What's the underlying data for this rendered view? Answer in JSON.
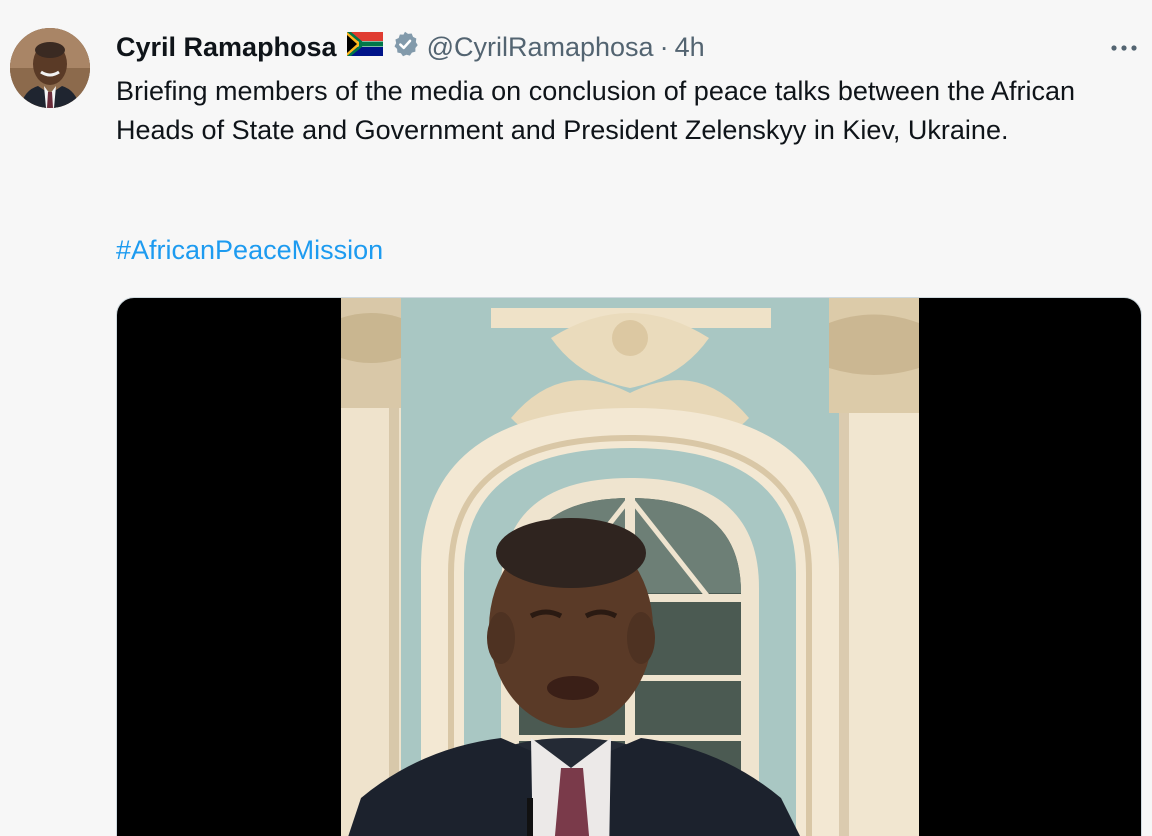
{
  "author": {
    "name": "Cyril Ramaphosa",
    "handle": "@CyrilRamaphosa",
    "separator": "·",
    "time": "4h",
    "flag_icon": "south-africa-flag-icon",
    "verified_icon": "verified-badge-icon",
    "avatar": "profile-photo"
  },
  "tweet": {
    "text": "Briefing members of the media on conclusion of peace talks between the African Heads of State and Government and President Zelenskyy in Kiev, Ukraine.",
    "hashtag": "#AfricanPeaceMission"
  },
  "menu": {
    "icon": "more-options-icon"
  },
  "media": {
    "type": "video",
    "description_icon": "video-thumbnail"
  },
  "colors": {
    "text": "#0f1419",
    "secondary": "#536471",
    "link": "#1d9bf0",
    "background": "#f7f7f7",
    "verified": "#829aab"
  }
}
